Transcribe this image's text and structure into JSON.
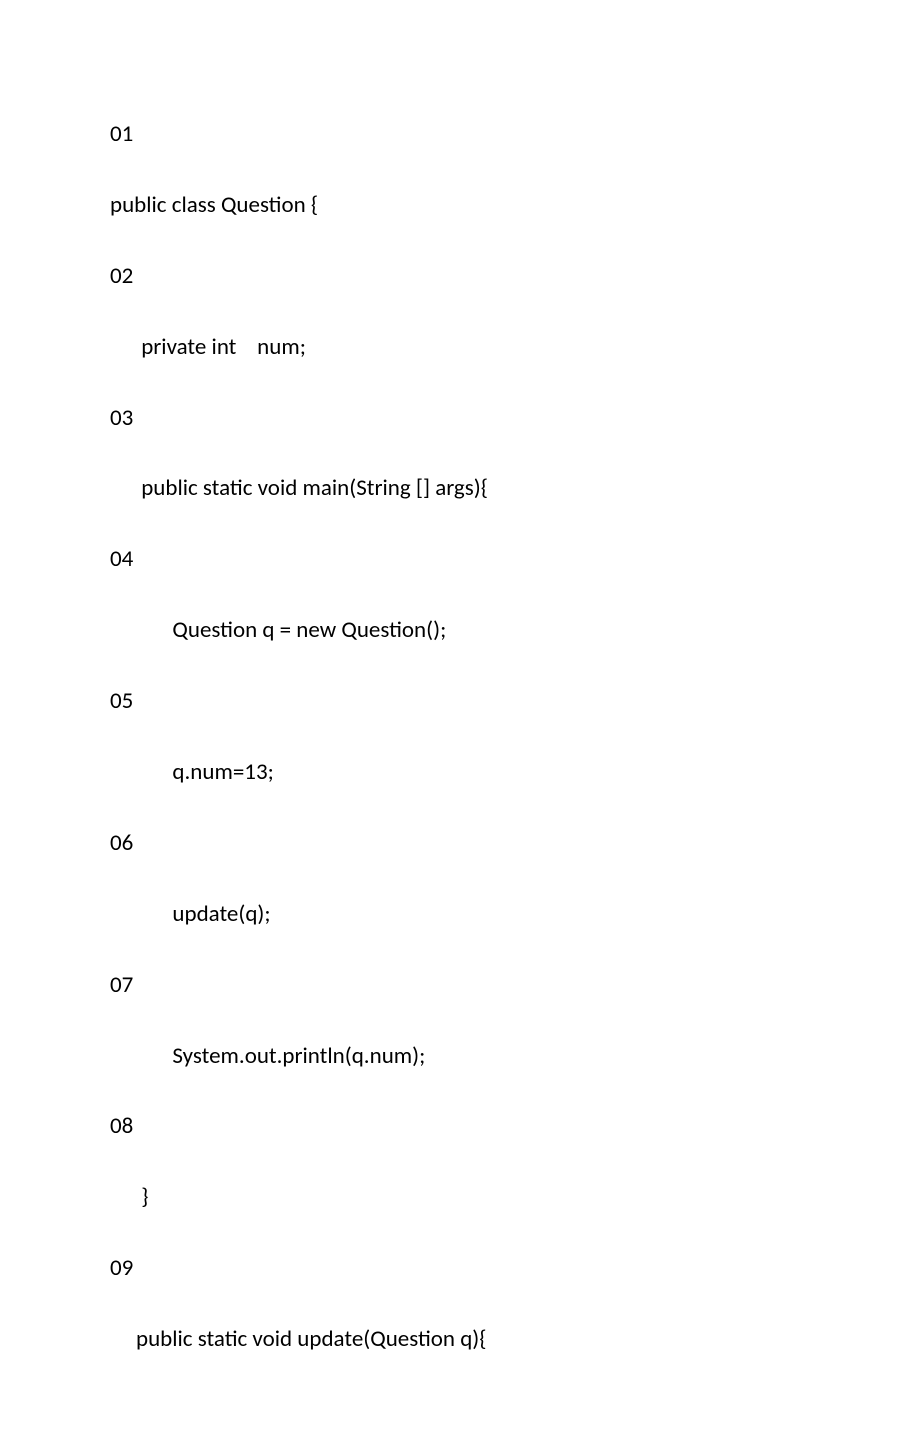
{
  "lines": [
    {
      "text": "01",
      "indent": 0
    },
    {
      "text": "public class Question {",
      "indent": 0
    },
    {
      "text": "02",
      "indent": 0
    },
    {
      "text": "      private int    num;",
      "indent": 0
    },
    {
      "text": "03",
      "indent": 0
    },
    {
      "text": "      public static void main(String [] args){",
      "indent": 0
    },
    {
      "text": "04",
      "indent": 0
    },
    {
      "text": "            Question q = new Question();",
      "indent": 0
    },
    {
      "text": "05",
      "indent": 0
    },
    {
      "text": "            q.num=13;",
      "indent": 0
    },
    {
      "text": "06",
      "indent": 0
    },
    {
      "text": "            update(q);",
      "indent": 0
    },
    {
      "text": "07",
      "indent": 0
    },
    {
      "text": "            System.out.println(q.num);",
      "indent": 0
    },
    {
      "text": "08",
      "indent": 0
    },
    {
      "text": "      }",
      "indent": 0
    },
    {
      "text": "09",
      "indent": 0
    },
    {
      "text": "     public static void update(Question q){",
      "indent": 0
    }
  ]
}
